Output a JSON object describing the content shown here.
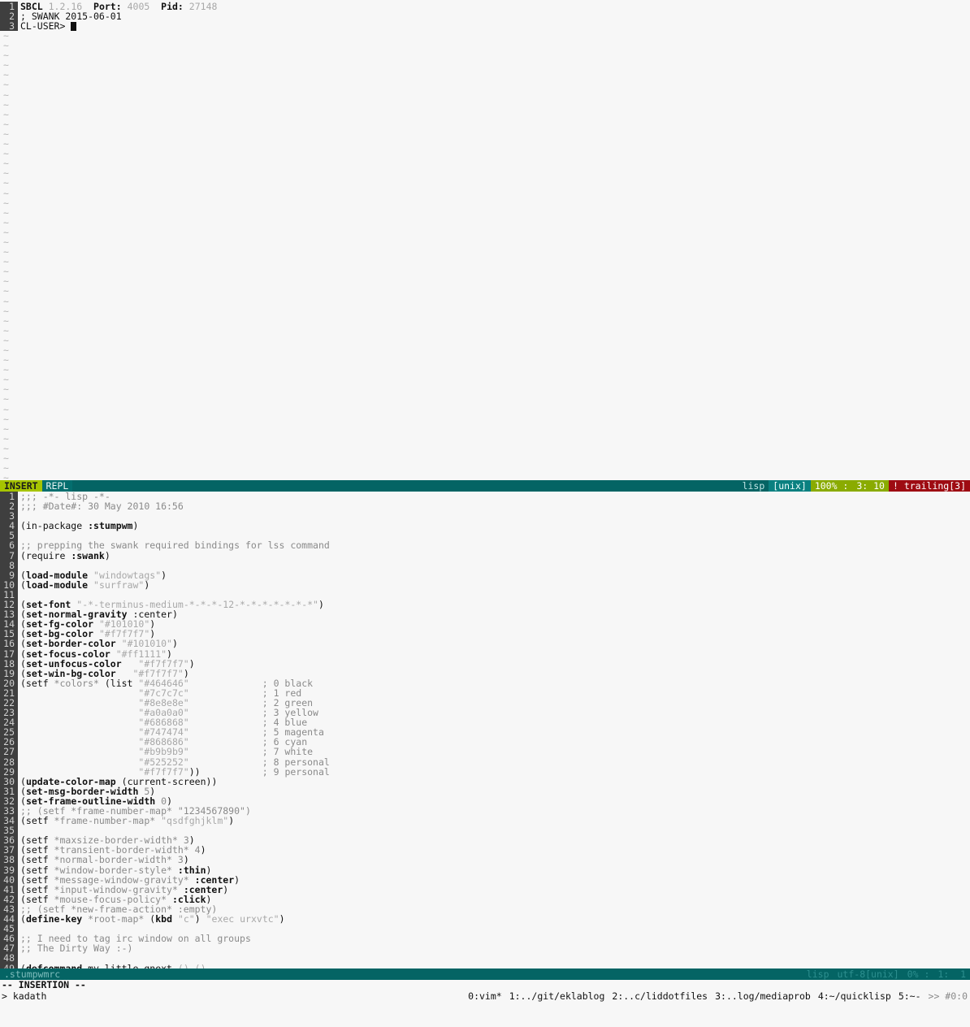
{
  "repl": {
    "lines": [
      {
        "n": "1",
        "segments": [
          {
            "t": "SBCL ",
            "c": "g-bold"
          },
          {
            "t": "1.2.16",
            "c": "g-dim"
          },
          {
            "t": "  ",
            "c": "g-dark"
          },
          {
            "t": "Port:",
            "c": "g-bold"
          },
          {
            "t": " ",
            "c": "g-dark"
          },
          {
            "t": "4005",
            "c": "g-dim"
          },
          {
            "t": "  ",
            "c": "g-dark"
          },
          {
            "t": "Pid:",
            "c": "g-bold"
          },
          {
            "t": " ",
            "c": "g-dark"
          },
          {
            "t": "27148",
            "c": "g-dim"
          }
        ]
      },
      {
        "n": "2",
        "segments": [
          {
            "t": "; SWANK 2015-06-01",
            "c": "g-dark"
          }
        ]
      },
      {
        "n": "3",
        "segments": [
          {
            "t": "CL-USER> ",
            "c": "g-dark"
          }
        ],
        "cursor": true
      }
    ],
    "tilde_count": 46,
    "tilde_char": "~"
  },
  "airline_repl": {
    "mode": "INSERT",
    "branch": "REPL",
    "filetype": "lisp",
    "encoding": "[unix]",
    "percent": "100% :",
    "position": "3: 10",
    "warning": "! trailing[3]"
  },
  "airline_file": {
    "filename": ".stumpwmrc",
    "filetype": "lisp",
    "encoding": "utf-8[unix]",
    "percent": "0% :",
    "position": "1:  1"
  },
  "code": {
    "lines": [
      {
        "n": "1",
        "segments": [
          {
            "t": ";;; -*- lisp -*-",
            "c": "g-mid"
          }
        ]
      },
      {
        "n": "2",
        "segments": [
          {
            "t": ";;; #Date#: 30 May 2010 16:56",
            "c": "g-mid"
          }
        ]
      },
      {
        "n": "3",
        "segments": []
      },
      {
        "n": "4",
        "segments": [
          {
            "t": "(in-package ",
            "c": "g-dark"
          },
          {
            "t": ":stumpwm",
            "c": "g-bold"
          },
          {
            "t": ")",
            "c": "g-dark"
          }
        ]
      },
      {
        "n": "5",
        "segments": []
      },
      {
        "n": "6",
        "segments": [
          {
            "t": ";; prepping the swank required bindings for lss command",
            "c": "g-mid"
          }
        ]
      },
      {
        "n": "7",
        "segments": [
          {
            "t": "(require ",
            "c": "g-dark"
          },
          {
            "t": ":swank",
            "c": "g-bold"
          },
          {
            "t": ")",
            "c": "g-dark"
          }
        ]
      },
      {
        "n": "8",
        "segments": []
      },
      {
        "n": "9",
        "segments": [
          {
            "t": "(",
            "c": "g-dark"
          },
          {
            "t": "load-module",
            "c": "g-bold"
          },
          {
            "t": " ",
            "c": "g-dark"
          },
          {
            "t": "\"windowtags\"",
            "c": "g-dim"
          },
          {
            "t": ")",
            "c": "g-dark"
          }
        ]
      },
      {
        "n": "10",
        "segments": [
          {
            "t": "(",
            "c": "g-dark"
          },
          {
            "t": "load-module",
            "c": "g-bold"
          },
          {
            "t": " ",
            "c": "g-dark"
          },
          {
            "t": "\"surfraw\"",
            "c": "g-dim"
          },
          {
            "t": ")",
            "c": "g-dark"
          }
        ]
      },
      {
        "n": "11",
        "segments": []
      },
      {
        "n": "12",
        "segments": [
          {
            "t": "(",
            "c": "g-dark"
          },
          {
            "t": "set-font",
            "c": "g-bold"
          },
          {
            "t": " ",
            "c": "g-dark"
          },
          {
            "t": "\"-*-terminus-medium-*-*-*-12-*-*-*-*-*-*-*\"",
            "c": "g-dim"
          },
          {
            "t": ")",
            "c": "g-dark"
          }
        ]
      },
      {
        "n": "13",
        "segments": [
          {
            "t": "(",
            "c": "g-dark"
          },
          {
            "t": "set-normal-gravity",
            "c": "g-bold"
          },
          {
            "t": " ",
            "c": "g-dark"
          },
          {
            "t": ":center",
            "c": "g-dark"
          },
          {
            "t": ")",
            "c": "g-dark"
          }
        ]
      },
      {
        "n": "14",
        "segments": [
          {
            "t": "(",
            "c": "g-dark"
          },
          {
            "t": "set-fg-color",
            "c": "g-bold"
          },
          {
            "t": " ",
            "c": "g-dark"
          },
          {
            "t": "\"#101010\"",
            "c": "g-dim"
          },
          {
            "t": ")",
            "c": "g-dark"
          }
        ]
      },
      {
        "n": "15",
        "segments": [
          {
            "t": "(",
            "c": "g-dark"
          },
          {
            "t": "set-bg-color",
            "c": "g-bold"
          },
          {
            "t": " ",
            "c": "g-dark"
          },
          {
            "t": "\"#f7f7f7\"",
            "c": "g-dim"
          },
          {
            "t": ")",
            "c": "g-dark"
          }
        ]
      },
      {
        "n": "16",
        "segments": [
          {
            "t": "(",
            "c": "g-dark"
          },
          {
            "t": "set-border-color",
            "c": "g-bold"
          },
          {
            "t": " ",
            "c": "g-dark"
          },
          {
            "t": "\"#101010\"",
            "c": "g-dim"
          },
          {
            "t": ")",
            "c": "g-dark"
          }
        ]
      },
      {
        "n": "17",
        "segments": [
          {
            "t": "(",
            "c": "g-dark"
          },
          {
            "t": "set-focus-color",
            "c": "g-bold"
          },
          {
            "t": " ",
            "c": "g-dark"
          },
          {
            "t": "\"#ff1111\"",
            "c": "g-dim"
          },
          {
            "t": ")",
            "c": "g-dark"
          }
        ]
      },
      {
        "n": "18",
        "segments": [
          {
            "t": "(",
            "c": "g-dark"
          },
          {
            "t": "set-unfocus-color",
            "c": "g-bold"
          },
          {
            "t": "   ",
            "c": "g-dark"
          },
          {
            "t": "\"#f7f7f7\"",
            "c": "g-dim"
          },
          {
            "t": ")",
            "c": "g-dark"
          }
        ]
      },
      {
        "n": "19",
        "segments": [
          {
            "t": "(",
            "c": "g-dark"
          },
          {
            "t": "set-win-bg-color",
            "c": "g-bold"
          },
          {
            "t": "   ",
            "c": "g-dark"
          },
          {
            "t": "\"#f7f7f7\"",
            "c": "g-dim"
          },
          {
            "t": ")",
            "c": "g-dark"
          }
        ]
      },
      {
        "n": "20",
        "segments": [
          {
            "t": "(setf ",
            "c": "g-dark"
          },
          {
            "t": "*colors*",
            "c": "g-mid"
          },
          {
            "t": " (list ",
            "c": "g-dark"
          },
          {
            "t": "\"#464646\"",
            "c": "g-dim"
          },
          {
            "t": "             ",
            "c": "g-dark"
          },
          {
            "t": "; 0 black",
            "c": "g-mid"
          }
        ]
      },
      {
        "n": "21",
        "segments": [
          {
            "t": "                     ",
            "c": "g-dark"
          },
          {
            "t": "\"#7c7c7c\"",
            "c": "g-dim"
          },
          {
            "t": "             ",
            "c": "g-dark"
          },
          {
            "t": "; 1 red",
            "c": "g-mid"
          }
        ]
      },
      {
        "n": "22",
        "segments": [
          {
            "t": "                     ",
            "c": "g-dark"
          },
          {
            "t": "\"#8e8e8e\"",
            "c": "g-dim"
          },
          {
            "t": "             ",
            "c": "g-dark"
          },
          {
            "t": "; 2 green",
            "c": "g-mid"
          }
        ]
      },
      {
        "n": "23",
        "segments": [
          {
            "t": "                     ",
            "c": "g-dark"
          },
          {
            "t": "\"#a0a0a0\"",
            "c": "g-dim"
          },
          {
            "t": "             ",
            "c": "g-dark"
          },
          {
            "t": "; 3 yellow",
            "c": "g-mid"
          }
        ]
      },
      {
        "n": "24",
        "segments": [
          {
            "t": "                     ",
            "c": "g-dark"
          },
          {
            "t": "\"#686868\"",
            "c": "g-dim"
          },
          {
            "t": "             ",
            "c": "g-dark"
          },
          {
            "t": "; 4 blue",
            "c": "g-mid"
          }
        ]
      },
      {
        "n": "25",
        "segments": [
          {
            "t": "                     ",
            "c": "g-dark"
          },
          {
            "t": "\"#747474\"",
            "c": "g-dim"
          },
          {
            "t": "             ",
            "c": "g-dark"
          },
          {
            "t": "; 5 magenta",
            "c": "g-mid"
          }
        ]
      },
      {
        "n": "26",
        "segments": [
          {
            "t": "                     ",
            "c": "g-dark"
          },
          {
            "t": "\"#868686\"",
            "c": "g-dim"
          },
          {
            "t": "             ",
            "c": "g-dark"
          },
          {
            "t": "; 6 cyan",
            "c": "g-mid"
          }
        ]
      },
      {
        "n": "27",
        "segments": [
          {
            "t": "                     ",
            "c": "g-dark"
          },
          {
            "t": "\"#b9b9b9\"",
            "c": "g-dim"
          },
          {
            "t": "             ",
            "c": "g-dark"
          },
          {
            "t": "; 7 white",
            "c": "g-mid"
          }
        ]
      },
      {
        "n": "28",
        "segments": [
          {
            "t": "                     ",
            "c": "g-dark"
          },
          {
            "t": "\"#525252\"",
            "c": "g-dim"
          },
          {
            "t": "             ",
            "c": "g-dark"
          },
          {
            "t": "; 8 personal",
            "c": "g-mid"
          }
        ]
      },
      {
        "n": "29",
        "segments": [
          {
            "t": "                     ",
            "c": "g-dark"
          },
          {
            "t": "\"#f7f7f7\"",
            "c": "g-dim"
          },
          {
            "t": "))",
            "c": "g-dark"
          },
          {
            "t": "           ",
            "c": "g-dark"
          },
          {
            "t": "; 9 personal",
            "c": "g-mid"
          }
        ]
      },
      {
        "n": "30",
        "segments": [
          {
            "t": "(",
            "c": "g-dark"
          },
          {
            "t": "update-color-map",
            "c": "g-bold"
          },
          {
            "t": " (",
            "c": "g-dark"
          },
          {
            "t": "current-screen",
            "c": "g-dark"
          },
          {
            "t": "))",
            "c": "g-dark"
          }
        ]
      },
      {
        "n": "31",
        "segments": [
          {
            "t": "(",
            "c": "g-dark"
          },
          {
            "t": "set-msg-border-width",
            "c": "g-bold"
          },
          {
            "t": " ",
            "c": "g-dark"
          },
          {
            "t": "5",
            "c": "g-mid"
          },
          {
            "t": ")",
            "c": "g-dark"
          }
        ]
      },
      {
        "n": "32",
        "segments": [
          {
            "t": "(",
            "c": "g-dark"
          },
          {
            "t": "set-frame-outline-width",
            "c": "g-bold"
          },
          {
            "t": " ",
            "c": "g-dark"
          },
          {
            "t": "0",
            "c": "g-mid"
          },
          {
            "t": ")",
            "c": "g-dark"
          }
        ]
      },
      {
        "n": "33",
        "segments": [
          {
            "t": ";; (setf *frame-number-map* \"1234567890\")",
            "c": "g-mid"
          }
        ]
      },
      {
        "n": "34",
        "segments": [
          {
            "t": "(setf ",
            "c": "g-dark"
          },
          {
            "t": "*frame-number-map*",
            "c": "g-mid"
          },
          {
            "t": " ",
            "c": "g-dark"
          },
          {
            "t": "\"qsdfghjklm\"",
            "c": "g-dim"
          },
          {
            "t": ")",
            "c": "g-dark"
          }
        ]
      },
      {
        "n": "35",
        "segments": []
      },
      {
        "n": "36",
        "segments": [
          {
            "t": "(setf ",
            "c": "g-dark"
          },
          {
            "t": "*maxsize-border-width*",
            "c": "g-mid"
          },
          {
            "t": " ",
            "c": "g-dark"
          },
          {
            "t": "3",
            "c": "g-mid"
          },
          {
            "t": ")",
            "c": "g-dark"
          }
        ]
      },
      {
        "n": "37",
        "segments": [
          {
            "t": "(setf ",
            "c": "g-dark"
          },
          {
            "t": "*transient-border-width*",
            "c": "g-mid"
          },
          {
            "t": " ",
            "c": "g-dark"
          },
          {
            "t": "4",
            "c": "g-mid"
          },
          {
            "t": ")",
            "c": "g-dark"
          }
        ]
      },
      {
        "n": "38",
        "segments": [
          {
            "t": "(setf ",
            "c": "g-dark"
          },
          {
            "t": "*normal-border-width*",
            "c": "g-mid"
          },
          {
            "t": " ",
            "c": "g-dark"
          },
          {
            "t": "3",
            "c": "g-mid"
          },
          {
            "t": ")",
            "c": "g-dark"
          }
        ]
      },
      {
        "n": "39",
        "segments": [
          {
            "t": "(setf ",
            "c": "g-dark"
          },
          {
            "t": "*window-border-style*",
            "c": "g-mid"
          },
          {
            "t": " ",
            "c": "g-dark"
          },
          {
            "t": ":thin",
            "c": "g-bold"
          },
          {
            "t": ")",
            "c": "g-dark"
          }
        ]
      },
      {
        "n": "40",
        "segments": [
          {
            "t": "(setf ",
            "c": "g-dark"
          },
          {
            "t": "*message-window-gravity*",
            "c": "g-mid"
          },
          {
            "t": " ",
            "c": "g-dark"
          },
          {
            "t": ":center",
            "c": "g-bold"
          },
          {
            "t": ")",
            "c": "g-dark"
          }
        ]
      },
      {
        "n": "41",
        "segments": [
          {
            "t": "(setf ",
            "c": "g-dark"
          },
          {
            "t": "*input-window-gravity*",
            "c": "g-mid"
          },
          {
            "t": " ",
            "c": "g-dark"
          },
          {
            "t": ":center",
            "c": "g-bold"
          },
          {
            "t": ")",
            "c": "g-dark"
          }
        ]
      },
      {
        "n": "42",
        "segments": [
          {
            "t": "(setf ",
            "c": "g-dark"
          },
          {
            "t": "*mouse-focus-policy*",
            "c": "g-mid"
          },
          {
            "t": " ",
            "c": "g-dark"
          },
          {
            "t": ":click",
            "c": "g-bold"
          },
          {
            "t": ")",
            "c": "g-dark"
          }
        ]
      },
      {
        "n": "43",
        "segments": [
          {
            "t": ";; (setf *new-frame-action* :empty)",
            "c": "g-mid"
          }
        ]
      },
      {
        "n": "44",
        "segments": [
          {
            "t": "(",
            "c": "g-dark"
          },
          {
            "t": "define-key",
            "c": "g-bold"
          },
          {
            "t": " ",
            "c": "g-dark"
          },
          {
            "t": "*root-map*",
            "c": "g-mid"
          },
          {
            "t": " (",
            "c": "g-dark"
          },
          {
            "t": "kbd",
            "c": "g-bold"
          },
          {
            "t": " ",
            "c": "g-dark"
          },
          {
            "t": "\"c\"",
            "c": "g-dim"
          },
          {
            "t": ") ",
            "c": "g-dark"
          },
          {
            "t": "\"exec urxvtc\"",
            "c": "g-dim"
          },
          {
            "t": ")",
            "c": "g-dark"
          }
        ]
      },
      {
        "n": "45",
        "segments": []
      },
      {
        "n": "46",
        "segments": [
          {
            "t": ";; I need to tag irc window on all groups",
            "c": "g-mid"
          }
        ]
      },
      {
        "n": "47",
        "segments": [
          {
            "t": ";; The Dirty Way :-)",
            "c": "g-mid"
          }
        ]
      },
      {
        "n": "48",
        "segments": []
      },
      {
        "n": "49",
        "segments": [
          {
            "t": "(",
            "c": "g-dark"
          },
          {
            "t": "defcommand",
            "c": "g-bold"
          },
          {
            "t": " my_little_gnext ",
            "c": "g-dark"
          },
          {
            "t": "() ()",
            "c": "g-dim"
          }
        ]
      }
    ]
  },
  "message_line": "-- INSERTION --",
  "tmux": {
    "prompt": "> kadath",
    "windows": [
      {
        "label": "0:vim*"
      },
      {
        "label": "1:../git/eklablog"
      },
      {
        "label": "2:..c/liddotfiles"
      },
      {
        "label": "3:..log/mediaprob"
      },
      {
        "label": "4:~/quicklisp"
      },
      {
        "label": "5:~-"
      }
    ],
    "session": ">> #0:0"
  }
}
